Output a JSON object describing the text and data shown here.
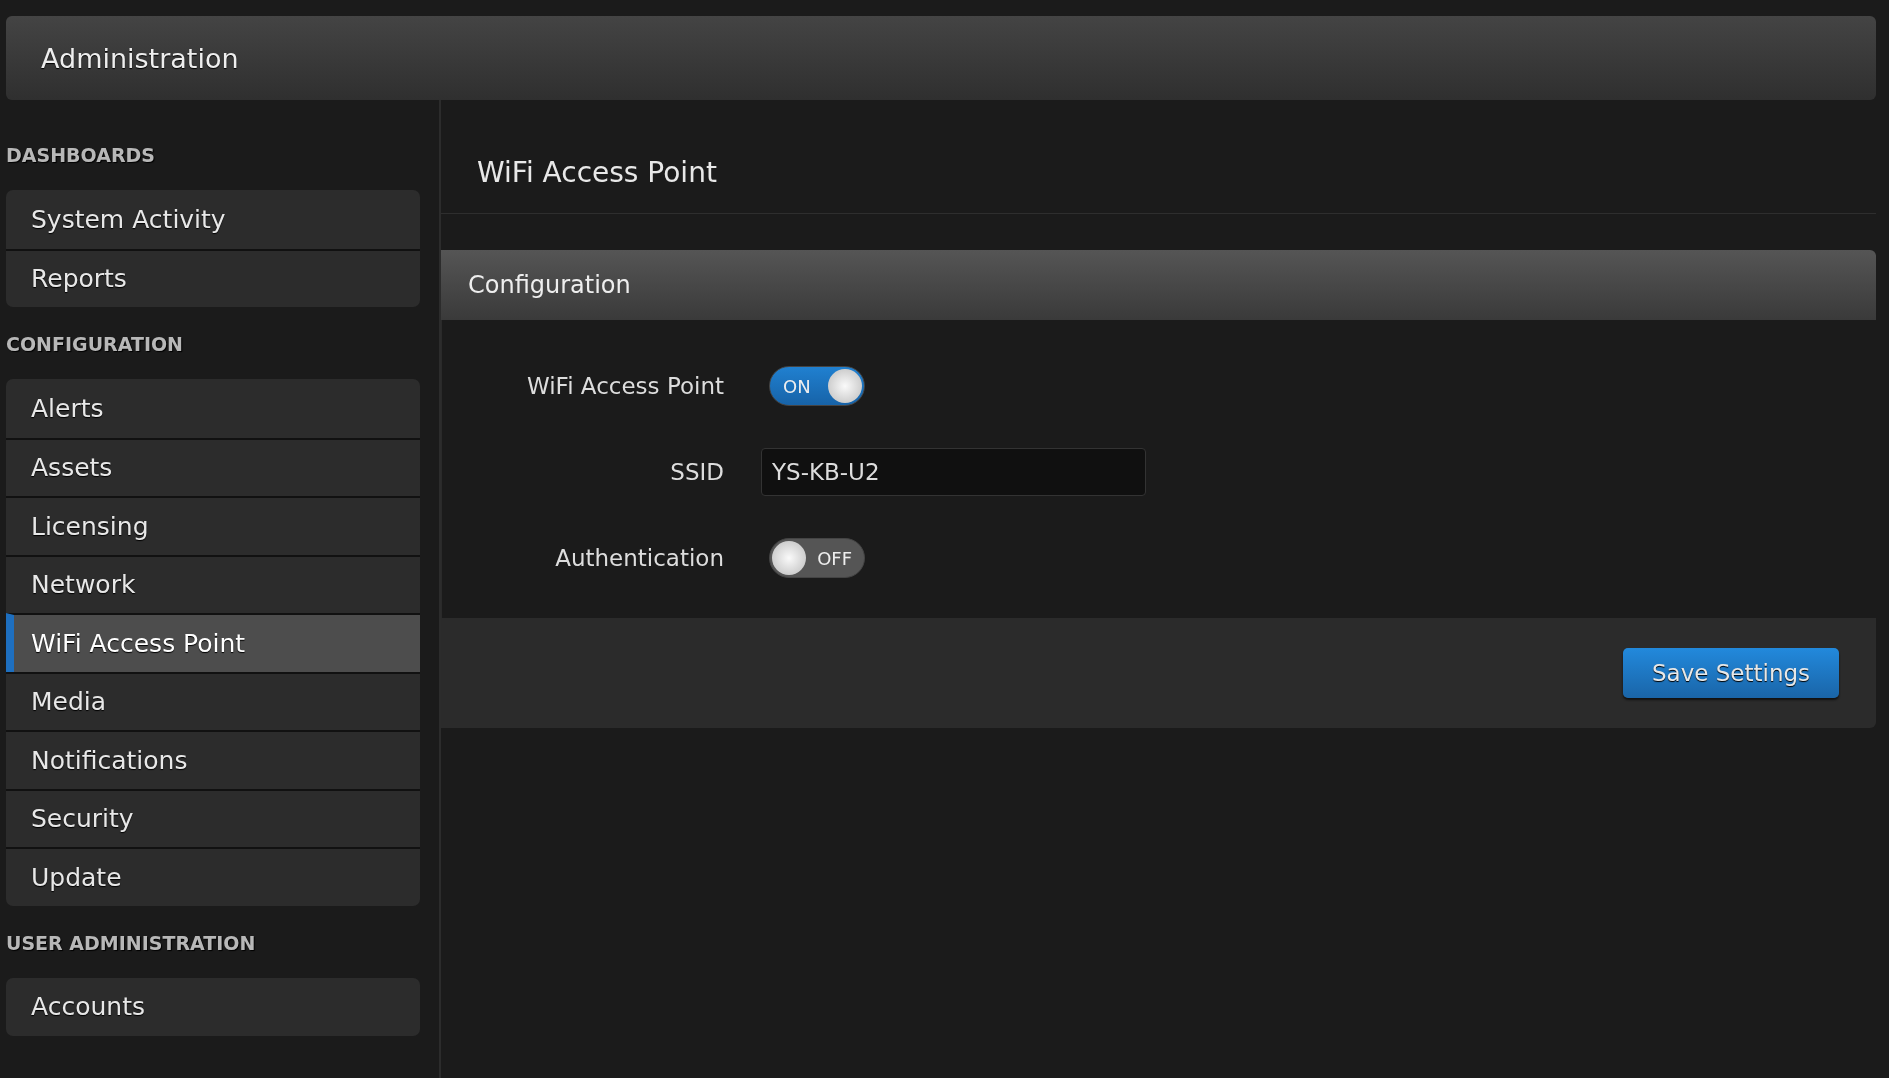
{
  "header": {
    "title": "Administration"
  },
  "sidebar": {
    "sections": [
      {
        "heading": "DASHBOARDS",
        "items": [
          {
            "label": "System Activity",
            "selected": false
          },
          {
            "label": "Reports",
            "selected": false
          }
        ]
      },
      {
        "heading": "CONFIGURATION",
        "items": [
          {
            "label": "Alerts",
            "selected": false
          },
          {
            "label": "Assets",
            "selected": false
          },
          {
            "label": "Licensing",
            "selected": false
          },
          {
            "label": "Network",
            "selected": false
          },
          {
            "label": "WiFi Access Point",
            "selected": true
          },
          {
            "label": "Media",
            "selected": false
          },
          {
            "label": "Notifications",
            "selected": false
          },
          {
            "label": "Security",
            "selected": false
          },
          {
            "label": "Update",
            "selected": false
          }
        ]
      },
      {
        "heading": "USER ADMINISTRATION",
        "items": [
          {
            "label": "Accounts",
            "selected": false
          }
        ]
      }
    ]
  },
  "page": {
    "title": "WiFi Access Point"
  },
  "panel": {
    "title": "Configuration",
    "fields": [
      {
        "kind": "toggle",
        "label": "WiFi Access Point",
        "on": true,
        "state_text": "ON"
      },
      {
        "kind": "text",
        "label": "SSID",
        "value": "YS-KB-U2"
      },
      {
        "kind": "toggle",
        "label": "Authentication",
        "on": false,
        "state_text": "OFF"
      }
    ],
    "save_button": "Save Settings"
  }
}
